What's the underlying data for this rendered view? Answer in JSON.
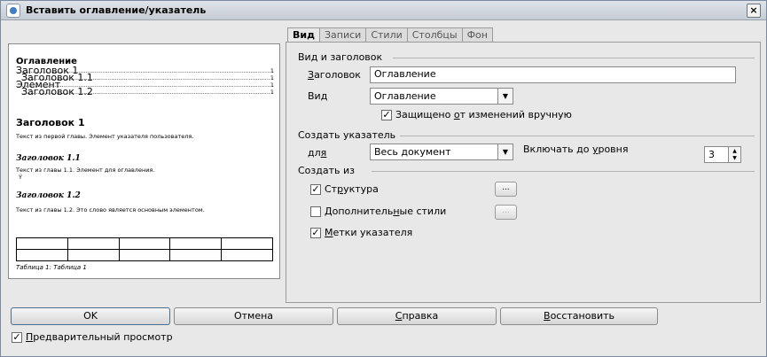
{
  "window": {
    "title": "Вставить оглавление/указатель",
    "close_label": "×"
  },
  "preview": {
    "toc_title": "Оглавление",
    "toc_lines": [
      {
        "label": "Заголовок 1",
        "page": "1"
      },
      {
        "label": "Заголовок 1.1",
        "page": "1"
      },
      {
        "label": "Элемент",
        "page": "1"
      },
      {
        "label": "Заголовок 1.2",
        "page": "1"
      }
    ],
    "heading1": "Заголовок 1",
    "text1": "Текст из первой главы. Элемент указателя пользователя.",
    "heading11": "Заголовок 1.1",
    "text11": "Текст из главы 1.1. Элемент для оглавления.",
    "text11_mark": "Ý",
    "heading12": "Заголовок 1.2",
    "text12": "Текст из главы 1.2. Это слово является основным элементом.",
    "caption": "Таблица 1: Таблица 1"
  },
  "tabs": [
    "Вид",
    "Записи",
    "Стили",
    "Столбцы",
    "Фон"
  ],
  "type_section": {
    "title": "Вид и заголовок",
    "heading_label_u": "З",
    "heading_label_rest": "аголовок",
    "heading_value": "Оглавление",
    "type_label_pre": "Ви",
    "type_label_u": "д",
    "type_value": "Оглавление",
    "protected_pre": "Защищено ",
    "protected_u": "о",
    "protected_rest": "т изменений вручную",
    "protected_checked": "✓"
  },
  "create_section": {
    "title": "Создать указатель",
    "for_label_pre": "дл",
    "for_label_u": "я",
    "for_value": "Весь документ",
    "level_label_pre": "Включать до ",
    "level_label_u": "у",
    "level_label_rest": "ровня",
    "level_value": "3"
  },
  "from_section": {
    "title": "Создать из",
    "structure_pre": "Ст",
    "structure_u": "р",
    "structure_rest": "уктура",
    "structure_checked": "✓",
    "structure_btn": "...",
    "styles_pre": "Дополнитель",
    "styles_u": "н",
    "styles_rest": "ые стили",
    "styles_btn": "...",
    "marks_u": "М",
    "marks_rest": "етки указателя",
    "marks_checked": "✓"
  },
  "buttons": {
    "ok": "OK",
    "cancel": "Отмена",
    "help_u": "С",
    "help_rest": "правка",
    "reset_u": "В",
    "reset_rest": "осстановить"
  },
  "preview_toggle": {
    "u": "П",
    "rest": "редварительный просмотр",
    "checked": "✓"
  }
}
